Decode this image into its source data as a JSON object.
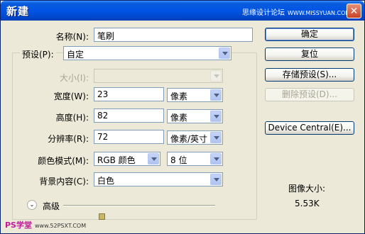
{
  "window": {
    "title": "新建",
    "close_glyph": "✕"
  },
  "watermark_top": {
    "site": "思缘设计论坛",
    "url": "WWW.MISSYUAN.COM"
  },
  "watermark_bottom": {
    "brand": "PS学堂",
    "url": "www.52PSXT.COM"
  },
  "fields": {
    "name": {
      "label": "名称(N):",
      "value": "笔刷"
    },
    "preset": {
      "label": "预设(P):",
      "value": "自定"
    },
    "size": {
      "label": "大小(I):",
      "value": ""
    },
    "width": {
      "label": "宽度(W):",
      "value": "23",
      "unit": "像素"
    },
    "height": {
      "label": "高度(H):",
      "value": "82",
      "unit": "像素"
    },
    "resolution": {
      "label": "分辨率(R):",
      "value": "72",
      "unit": "像素/英寸"
    },
    "color_mode": {
      "label": "颜色模式(M):",
      "value": "RGB 颜色",
      "depth": "8 位"
    },
    "background": {
      "label": "背景内容(C):",
      "value": "白色"
    }
  },
  "advanced": {
    "label": "高级",
    "icon": "double-chevron-down-icon"
  },
  "buttons": {
    "ok": "确定",
    "reset": "复位",
    "save_preset": "存储预设(S)...",
    "delete_preset": "删除预设(D)...",
    "device_central": "Device Central(E)..."
  },
  "image_size": {
    "label": "图像大小:",
    "value": "5.53K"
  },
  "colors": {
    "titlebar": "#0054e3",
    "dialog_bg": "#ece9d8"
  }
}
